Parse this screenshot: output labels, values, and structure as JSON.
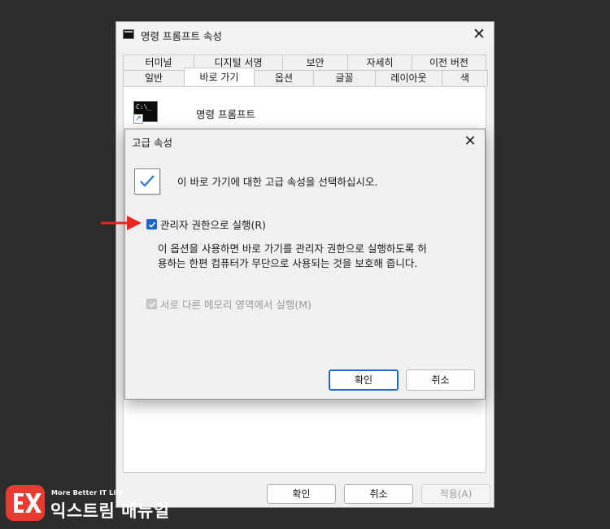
{
  "window": {
    "title": "명령 프롬프트 속성",
    "tabs_row1": [
      "터미널",
      "디지털 서명",
      "보안",
      "자세히",
      "이전 버전"
    ],
    "tabs_row2": [
      "일반",
      "바로 가기",
      "옵션",
      "글꼴",
      "레이아웃",
      "색"
    ],
    "active_tab": "바로 가기",
    "app_name": "명령 프롬프트",
    "icon_text": "C:\\_",
    "buttons": {
      "ok": "확인",
      "cancel": "취소",
      "apply": "적용(A)"
    }
  },
  "dialog": {
    "title": "고급 속성",
    "heading": "이 바로 가기에 대한 고급 속성을 선택하십시오.",
    "run_as_admin": {
      "label": "관리자 권한으로 실행(R)",
      "checked": true,
      "description_line1": "이 옵션을 사용하면 바로 가기를 관리자 권한으로 실행하도록 허",
      "description_line2": "용하는 한편 컴퓨터가 무단으로 사용되는 것을 보호해 줍니다."
    },
    "separate_memory": {
      "label": "서로 다른 메모리 영역에서 실행(M)",
      "checked": true,
      "disabled": true
    },
    "buttons": {
      "ok": "확인",
      "cancel": "취소"
    }
  },
  "colors": {
    "accent": "#1e67c8",
    "arrow": "#e8281e",
    "watermark_logo": "#e63b30"
  },
  "watermark": {
    "logo_icon": "ex-logo-icon",
    "tagline": "More Better IT Life",
    "brand": "익스트림 매뉴얼"
  }
}
